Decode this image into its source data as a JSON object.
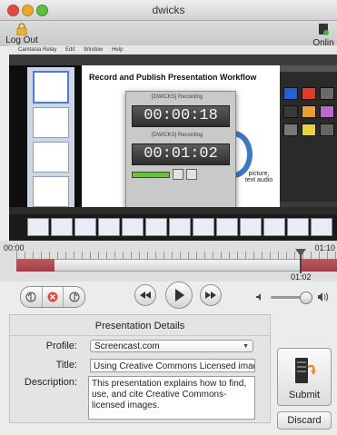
{
  "window": {
    "title": "dwicks"
  },
  "toolbar": {
    "logout_label": "Log Out",
    "online_label": "Onlin"
  },
  "video": {
    "menubar": [
      "Camtasia Relay",
      "Edit",
      "Window",
      "Help"
    ],
    "slide_title": "Record and Publish Presentation Workflow",
    "slide_caption": "picture, text audio",
    "recorder_header": "[DWICKS] Recording",
    "recorder_timer_top": "00:00:18",
    "recorder_timer_main": "00:01:02"
  },
  "scrubber": {
    "start_time": "00:00",
    "end_time": "01:10",
    "current_time": "01:02"
  },
  "details": {
    "title": "Presentation Details",
    "profile_label": "Profile:",
    "profile_value": "Screencast.com",
    "title_label": "Title:",
    "title_value": "Using Creative Commons Licensed images",
    "description_label": "Description:",
    "description_value": "This presentation explains how to find, use, and cite Creative Commons-licensed images."
  },
  "actions": {
    "submit_label": "Submit",
    "discard_label": "Discard"
  },
  "colors": {
    "track": "#a03d45",
    "accent_red": "#e53a2a"
  }
}
